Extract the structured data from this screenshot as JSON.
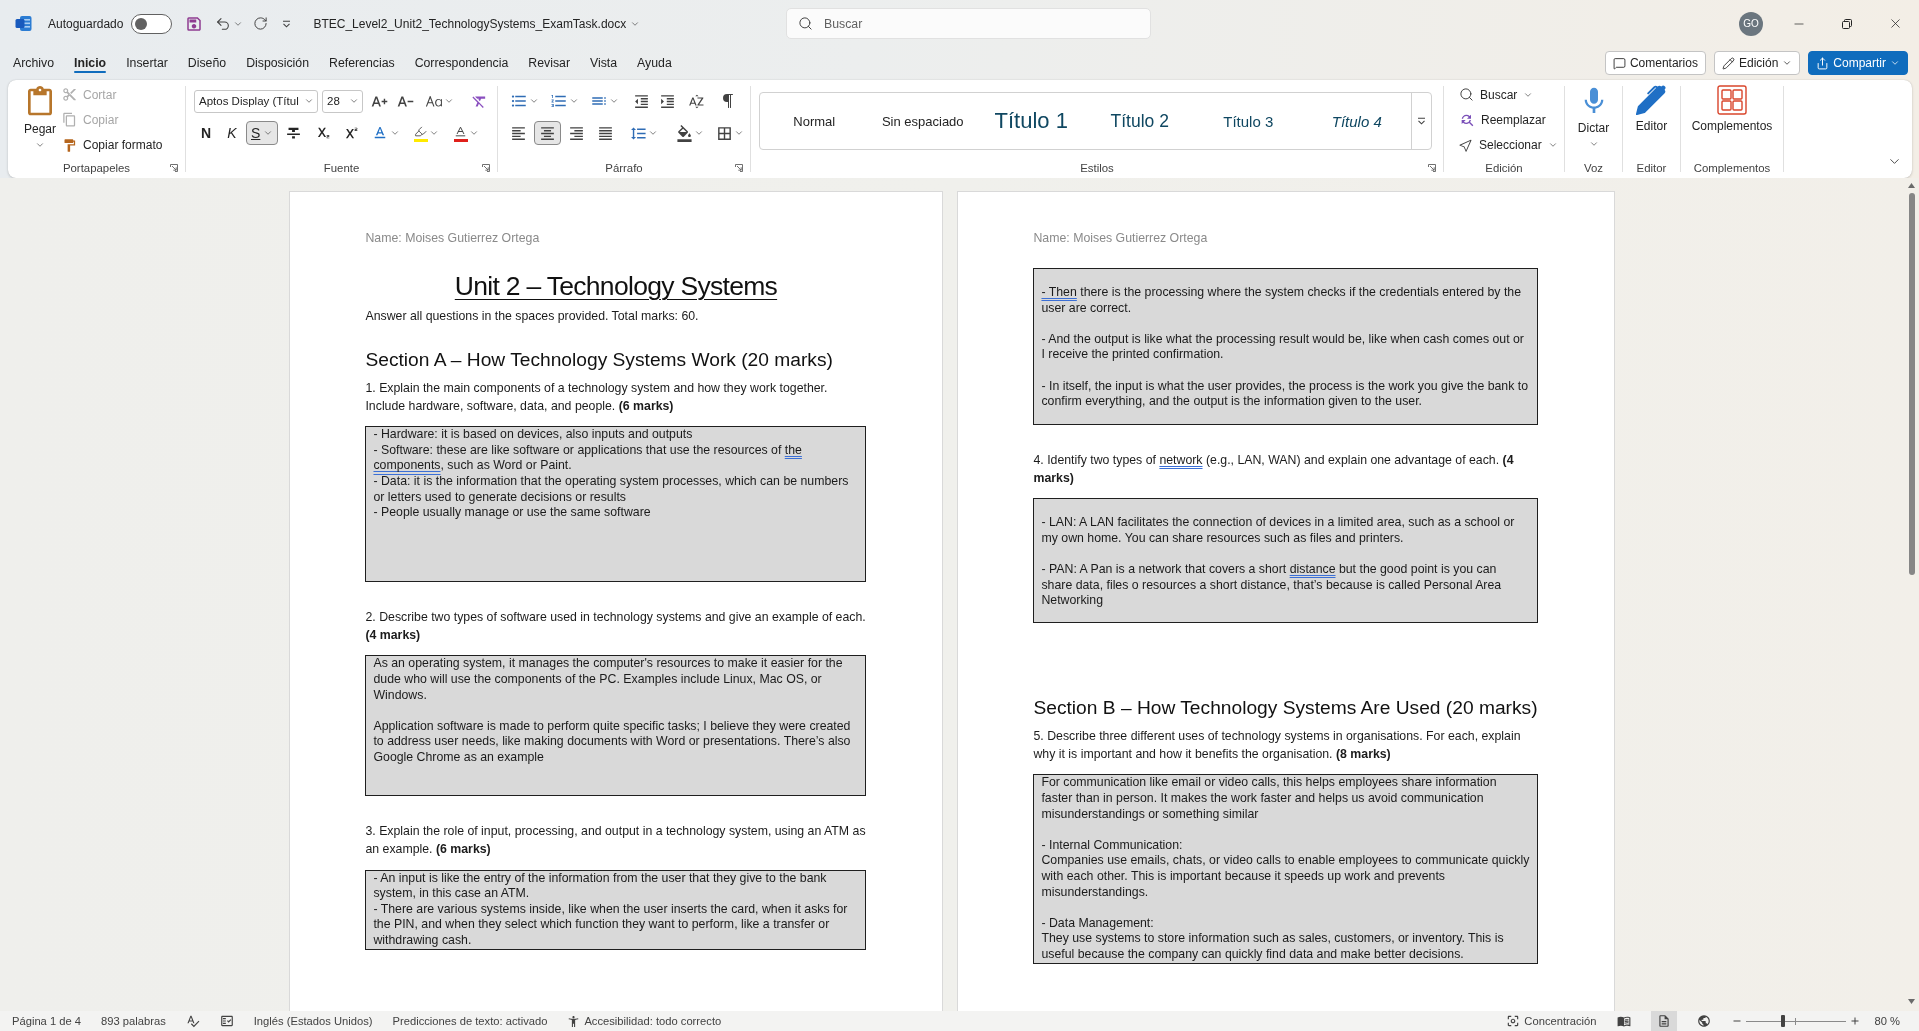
{
  "title_bar": {
    "autosave": {
      "label": "Autoguardado",
      "on": false
    },
    "file_name": "BTEC_Level2_Unit2_TechnologySystems_ExamTask.docx",
    "search": {
      "placeholder": "Buscar"
    },
    "account": {
      "initials": "GO"
    }
  },
  "menu_tabs": [
    {
      "label": "Archivo",
      "selected": false
    },
    {
      "label": "Inicio",
      "selected": true
    },
    {
      "label": "Insertar",
      "selected": false
    },
    {
      "label": "Diseño",
      "selected": false
    },
    {
      "label": "Disposición",
      "selected": false
    },
    {
      "label": "Referencias",
      "selected": false
    },
    {
      "label": "Correspondencia",
      "selected": false
    },
    {
      "label": "Revisar",
      "selected": false
    },
    {
      "label": "Vista",
      "selected": false
    },
    {
      "label": "Ayuda",
      "selected": false
    }
  ],
  "header_buttons": [
    {
      "kind": "comments",
      "label": "Comentarios"
    },
    {
      "kind": "editing_mode",
      "label": "Edición"
    },
    {
      "kind": "share",
      "label": "Compartir"
    }
  ],
  "ribbon": {
    "clipboard": {
      "label": "Portapapeles",
      "paste": "Pegar",
      "actions": [
        {
          "kind": "cut",
          "label": "Cortar",
          "disabled": true
        },
        {
          "kind": "copy",
          "label": "Copiar",
          "disabled": true
        },
        {
          "kind": "format_painter",
          "label": "Copiar formato",
          "disabled": false
        }
      ]
    },
    "font": {
      "label": "Fuente",
      "font_name": "Aptos Display (Títul",
      "font_size": "28",
      "format_buttons": [
        {
          "kind": "bold",
          "label": "N",
          "pressed": false
        },
        {
          "kind": "italic",
          "label": "K",
          "pressed": false
        },
        {
          "kind": "underline",
          "label": "S",
          "pressed": true
        },
        {
          "kind": "strikethrough",
          "pressed": false
        },
        {
          "kind": "subscript",
          "pressed": false
        },
        {
          "kind": "superscript",
          "pressed": false
        }
      ]
    },
    "paragraph": {
      "label": "Párrafo",
      "alignment": [
        {
          "kind": "left",
          "selected": false
        },
        {
          "kind": "center",
          "selected": true
        },
        {
          "kind": "right",
          "selected": false
        },
        {
          "kind": "justify",
          "selected": false
        }
      ]
    },
    "styles": {
      "label": "Estilos",
      "items": [
        {
          "kind": "normal",
          "label": "Normal"
        },
        {
          "kind": "no_spacing",
          "label": "Sin espaciado"
        },
        {
          "kind": "heading1",
          "label": "Título 1"
        },
        {
          "kind": "heading2",
          "label": "Título 2"
        },
        {
          "kind": "heading3",
          "label": "Título 3"
        },
        {
          "kind": "heading4",
          "label": "Título 4"
        }
      ]
    },
    "editing": {
      "label": "Edición",
      "actions": [
        {
          "kind": "find",
          "label": "Buscar"
        },
        {
          "kind": "replace",
          "label": "Reemplazar"
        },
        {
          "kind": "select",
          "label": "Seleccionar"
        }
      ]
    },
    "voice": {
      "label": "Voz",
      "button": "Dictar"
    },
    "editor": {
      "label": "Editor",
      "button": "Editor"
    },
    "addins": {
      "label": "Complementos",
      "button": "Complementos"
    }
  },
  "document": {
    "pages": [
      {
        "header": "Name: Moises Gutierrez Ortega",
        "blocks": [
          {
            "kind": "title",
            "text": "Unit 2 – Technology Systems"
          },
          {
            "kind": "paragraph",
            "text": "Answer all questions in the spaces provided. Total marks: 60."
          },
          {
            "kind": "section_heading",
            "text": "Section A – How Technology Systems Work (20 marks)"
          },
          {
            "kind": "question",
            "parts": [
              {
                "text": "1. Explain the main components of a technology system and how they work together. Include hardware, software, data, and people. **(6 marks)**",
                "flagged": false
              }
            ]
          },
          {
            "kind": "answer_box",
            "groups": [
              [
                {
                  "parts": [
                    {
                      "text": "- Hardware: it is based on devices, also inputs and outputs",
                      "flagged": false
                    }
                  ]
                },
                {
                  "parts": [
                    {
                      "text": "- Software: these are like software or applications that use the resources of ",
                      "flagged": false
                    },
                    {
                      "text": "the components",
                      "flagged": true
                    },
                    {
                      "text": ", such as Word or Paint.",
                      "flagged": false
                    }
                  ]
                },
                {
                  "parts": [
                    {
                      "text": "- Data: it is the information that the operating system processes, which can be numbers or letters used to generate decisions or results",
                      "flagged": false
                    }
                  ]
                },
                {
                  "parts": [
                    {
                      "text": "- People usually manage or use the same software",
                      "flagged": false
                    }
                  ]
                }
              ]
            ]
          },
          {
            "kind": "question",
            "parts": [
              {
                "text": "2. Describe two types of software used in technology systems and give an example of each. **(4 marks)**",
                "flagged": false
              }
            ]
          },
          {
            "kind": "answer_box",
            "groups": [
              [
                {
                  "parts": [
                    {
                      "text": "As an operating system, it manages the computer's resources to make it easier for the dude who will use the components of the PC. Examples include Linux, Mac OS, or Windows.",
                      "flagged": false
                    }
                  ]
                }
              ],
              [
                {
                  "parts": [
                    {
                      "text": "Application software is made to perform quite specific tasks; I believe they were created to address user needs, like making documents with Word or presentations. There’s also Google Chrome as an example",
                      "flagged": false
                    }
                  ]
                }
              ]
            ]
          },
          {
            "kind": "question",
            "parts": [
              {
                "text": "3. Explain the role of input, processing, and output in a technology system, using an ATM as an example. **(6 marks)**",
                "flagged": false
              }
            ]
          },
          {
            "kind": "answer_box",
            "groups": [
              [
                {
                  "parts": [
                    {
                      "text": "- An input is like the entry of the information from the user that they give to the bank system, in this case an ATM.",
                      "flagged": false
                    }
                  ]
                },
                {
                  "parts": [
                    {
                      "text": "- There are various systems inside, like when the user inserts the card, when it asks for the PIN, and when they select which function they want to perform, like a transfer or withdrawing cash.",
                      "flagged": false
                    }
                  ]
                }
              ]
            ]
          }
        ]
      },
      {
        "header": "Name: Moises Gutierrez Ortega",
        "blocks": [
          {
            "kind": "answer_box",
            "groups": [
              [
                {
                  "parts": [
                    {
                      "text": "- Then",
                      "flagged": true
                    },
                    {
                      "text": " there is the processing where the system checks if the credentials entered by the user are correct.",
                      "flagged": false
                    }
                  ]
                }
              ],
              [
                {
                  "parts": [
                    {
                      "text": "- And the output is like what the processing result would be, like when cash comes out or I receive the printed confirmation.",
                      "flagged": false
                    }
                  ]
                }
              ],
              [
                {
                  "parts": [
                    {
                      "text": "- In itself, the input is what the user provides, the process is the work you give the bank to confirm everything, and the output is the information given to the user.",
                      "flagged": false
                    }
                  ]
                }
              ]
            ]
          },
          {
            "kind": "question",
            "parts": [
              {
                "text": "4. Identify two types of ",
                "flagged": false
              },
              {
                "text": "network",
                "flagged": true
              },
              {
                "text": " (e.g., LAN, WAN) and explain one advantage of each. **(4 marks)**",
                "flagged": false
              }
            ]
          },
          {
            "kind": "answer_box",
            "groups": [
              [
                {
                  "parts": [
                    {
                      "text": "- LAN: A LAN facilitates the connection of devices in a limited area, such as a school or my own home. You can share resources such as files and printers.",
                      "flagged": false
                    }
                  ]
                }
              ],
              [
                {
                  "parts": [
                    {
                      "text": "- PAN: A Pan is a network that covers a short ",
                      "flagged": false
                    },
                    {
                      "text": "distance",
                      "flagged": true
                    },
                    {
                      "text": " but the good point is you can share data, files o resources a short distance, that’s because is called Personal Area Networking",
                      "flagged": false
                    }
                  ]
                }
              ]
            ]
          },
          {
            "kind": "section_heading",
            "text": "Section B – How Technology Systems Are Used (20 marks)"
          },
          {
            "kind": "question",
            "parts": [
              {
                "text": "5. Describe three different uses of technology systems in organisations. For each, explain why it is important and how it benefits the organisation. **(8 marks)**",
                "flagged": false
              }
            ]
          },
          {
            "kind": "answer_box",
            "groups": [
              [
                {
                  "parts": [
                    {
                      "text": "For communication like email or video calls, this helps employees share information faster than in person. It makes the work faster and helps us avoid communication misunderstandings or something similar",
                      "flagged": false
                    }
                  ]
                }
              ],
              [
                {
                  "parts": [
                    {
                      "text": "- Internal Communication:",
                      "flagged": false
                    }
                  ]
                },
                {
                  "parts": [
                    {
                      "text": "Companies use emails, chats, or video calls to enable employees to communicate quickly with each other. This is important because it speeds up work and prevents misunderstandings.",
                      "flagged": false
                    }
                  ]
                }
              ],
              [
                {
                  "parts": [
                    {
                      "text": "- Data Management:",
                      "flagged": false
                    }
                  ]
                },
                {
                  "parts": [
                    {
                      "text": "They use systems to store information such as sales, customers, or inventory. This is useful because the company can quickly find data and make better decisions.",
                      "flagged": false
                    }
                  ]
                }
              ]
            ]
          }
        ]
      }
    ]
  },
  "status_bar": {
    "page": "Página 1 de 4",
    "words": "893 palabras",
    "language": "Inglés (Estados Unidos)",
    "text_predictions": "Predicciones de texto: activado",
    "accessibility": "Accesibilidad: todo correcto",
    "focus": "Concentración",
    "views": [
      {
        "kind": "read",
        "selected": false
      },
      {
        "kind": "print",
        "selected": true
      },
      {
        "kind": "web",
        "selected": false
      }
    ],
    "zoom": {
      "level": 0.37,
      "reading": "80 %"
    }
  }
}
